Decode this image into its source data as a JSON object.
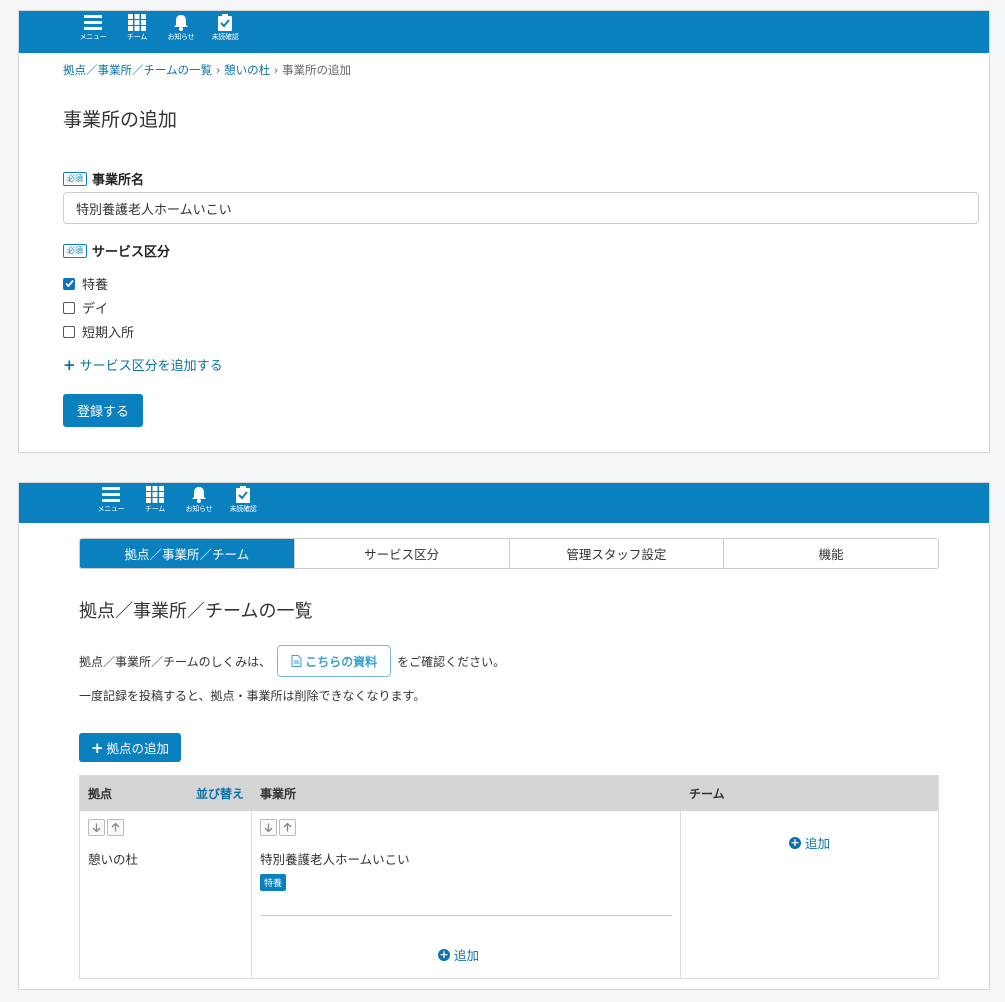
{
  "nav": {
    "items": [
      {
        "label": "メニュー",
        "icon": "menu-icon"
      },
      {
        "label": "チーム",
        "icon": "grid-icon"
      },
      {
        "label": "お知らせ",
        "icon": "bell-icon"
      },
      {
        "label": "未読確認",
        "icon": "clipboard-check-icon"
      }
    ]
  },
  "add_office": {
    "breadcrumb": {
      "link1": "拠点／事業所／チームの一覧",
      "sep": "›",
      "link2": "憩いの杜",
      "current": "事業所の追加"
    },
    "title": "事業所の追加",
    "required_badge": "必須",
    "office_name_label": "事業所名",
    "office_name_value": "特別養護老人ホームいこい",
    "service_label": "サービス区分",
    "services": [
      {
        "label": "特養",
        "checked": true
      },
      {
        "label": "デイ",
        "checked": false
      },
      {
        "label": "短期入所",
        "checked": false
      }
    ],
    "add_service_link": "サービス区分を追加する",
    "register_button": "登録する"
  },
  "list_page": {
    "tabs": [
      {
        "label": "拠点／事業所／チーム",
        "active": true
      },
      {
        "label": "サービス区分",
        "active": false
      },
      {
        "label": "管理スタッフ設定",
        "active": false
      },
      {
        "label": "機能",
        "active": false
      }
    ],
    "title": "拠点／事業所／チームの一覧",
    "info_prefix": "拠点／事業所／チームのしくみは、",
    "doc_button": "こちらの資料",
    "info_suffix": "をご確認ください。",
    "info_line2": "一度記録を投稿すると、拠点・事業所は削除できなくなります。",
    "add_base_button": "拠点の追加",
    "table": {
      "headers": {
        "base": "拠点",
        "sort": "並び替え",
        "office": "事業所",
        "team": "チーム"
      },
      "base_name": "憩いの杜",
      "office_name": "特別養護老人ホームいこい",
      "office_badge": "特養",
      "add_label": "追加"
    }
  },
  "colors": {
    "accent": "#0a80bf",
    "link": "#0a72a8"
  }
}
